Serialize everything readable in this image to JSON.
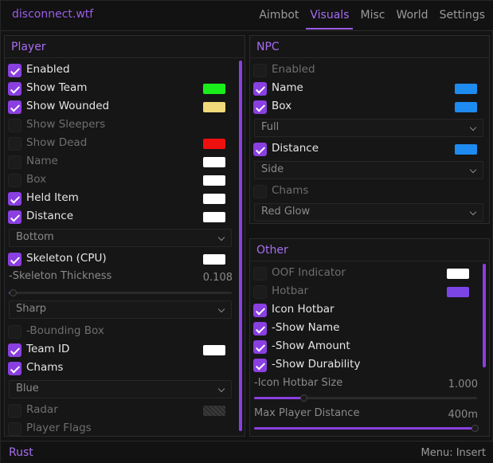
{
  "app": {
    "brand": "disconnect.wtf"
  },
  "tabs": [
    "Aimbot",
    "Visuals",
    "Misc",
    "World",
    "Settings"
  ],
  "active_tab": "Visuals",
  "player": {
    "title": "Player",
    "enabled": "Enabled",
    "show_team": "Show Team",
    "show_wounded": "Show Wounded",
    "show_sleepers": "Show Sleepers",
    "show_dead": "Show Dead",
    "name": "Name",
    "box": "Box",
    "held_item": "Held Item",
    "distance": "Distance",
    "distance_pos": "Bottom",
    "skeleton": "Skeleton (CPU)",
    "skeleton_thickness_label": "-Skeleton Thickness",
    "skeleton_thickness_value": "0.108",
    "skeleton_style": "Sharp",
    "bounding_box": "-Bounding Box",
    "team_id": "Team ID",
    "chams": "Chams",
    "chams_color": "Blue",
    "radar": "Radar",
    "player_flags": "Player Flags"
  },
  "npc": {
    "title": "NPC",
    "enabled": "Enabled",
    "name": "Name",
    "box": "Box",
    "box_style": "Full",
    "distance": "Distance",
    "distance_pos": "Side",
    "chams": "Chams",
    "chams_style": "Red Glow"
  },
  "other": {
    "title": "Other",
    "oof_indicator": "OOF Indicator",
    "hotbar": "Hotbar",
    "icon_hotbar": "Icon Hotbar",
    "show_name": "-Show Name",
    "show_amount": "-Show Amount",
    "show_durability": "-Show Durability",
    "icon_hotbar_size_label": "-Icon Hotbar Size",
    "icon_hotbar_size_value": "1.000",
    "max_player_distance_label": "Max Player Distance",
    "max_player_distance_value": "400m"
  },
  "colors": {
    "accent": "#8a3fe0",
    "team": "#1aee1a",
    "wounded": "#f0d97a",
    "dead": "#ee0f0f",
    "white": "#ffffff",
    "npc_blue": "#1e8bf0",
    "hotbar_purple": "#7b45e6"
  },
  "footer": {
    "left": "Rust",
    "right": "Menu: Insert"
  }
}
